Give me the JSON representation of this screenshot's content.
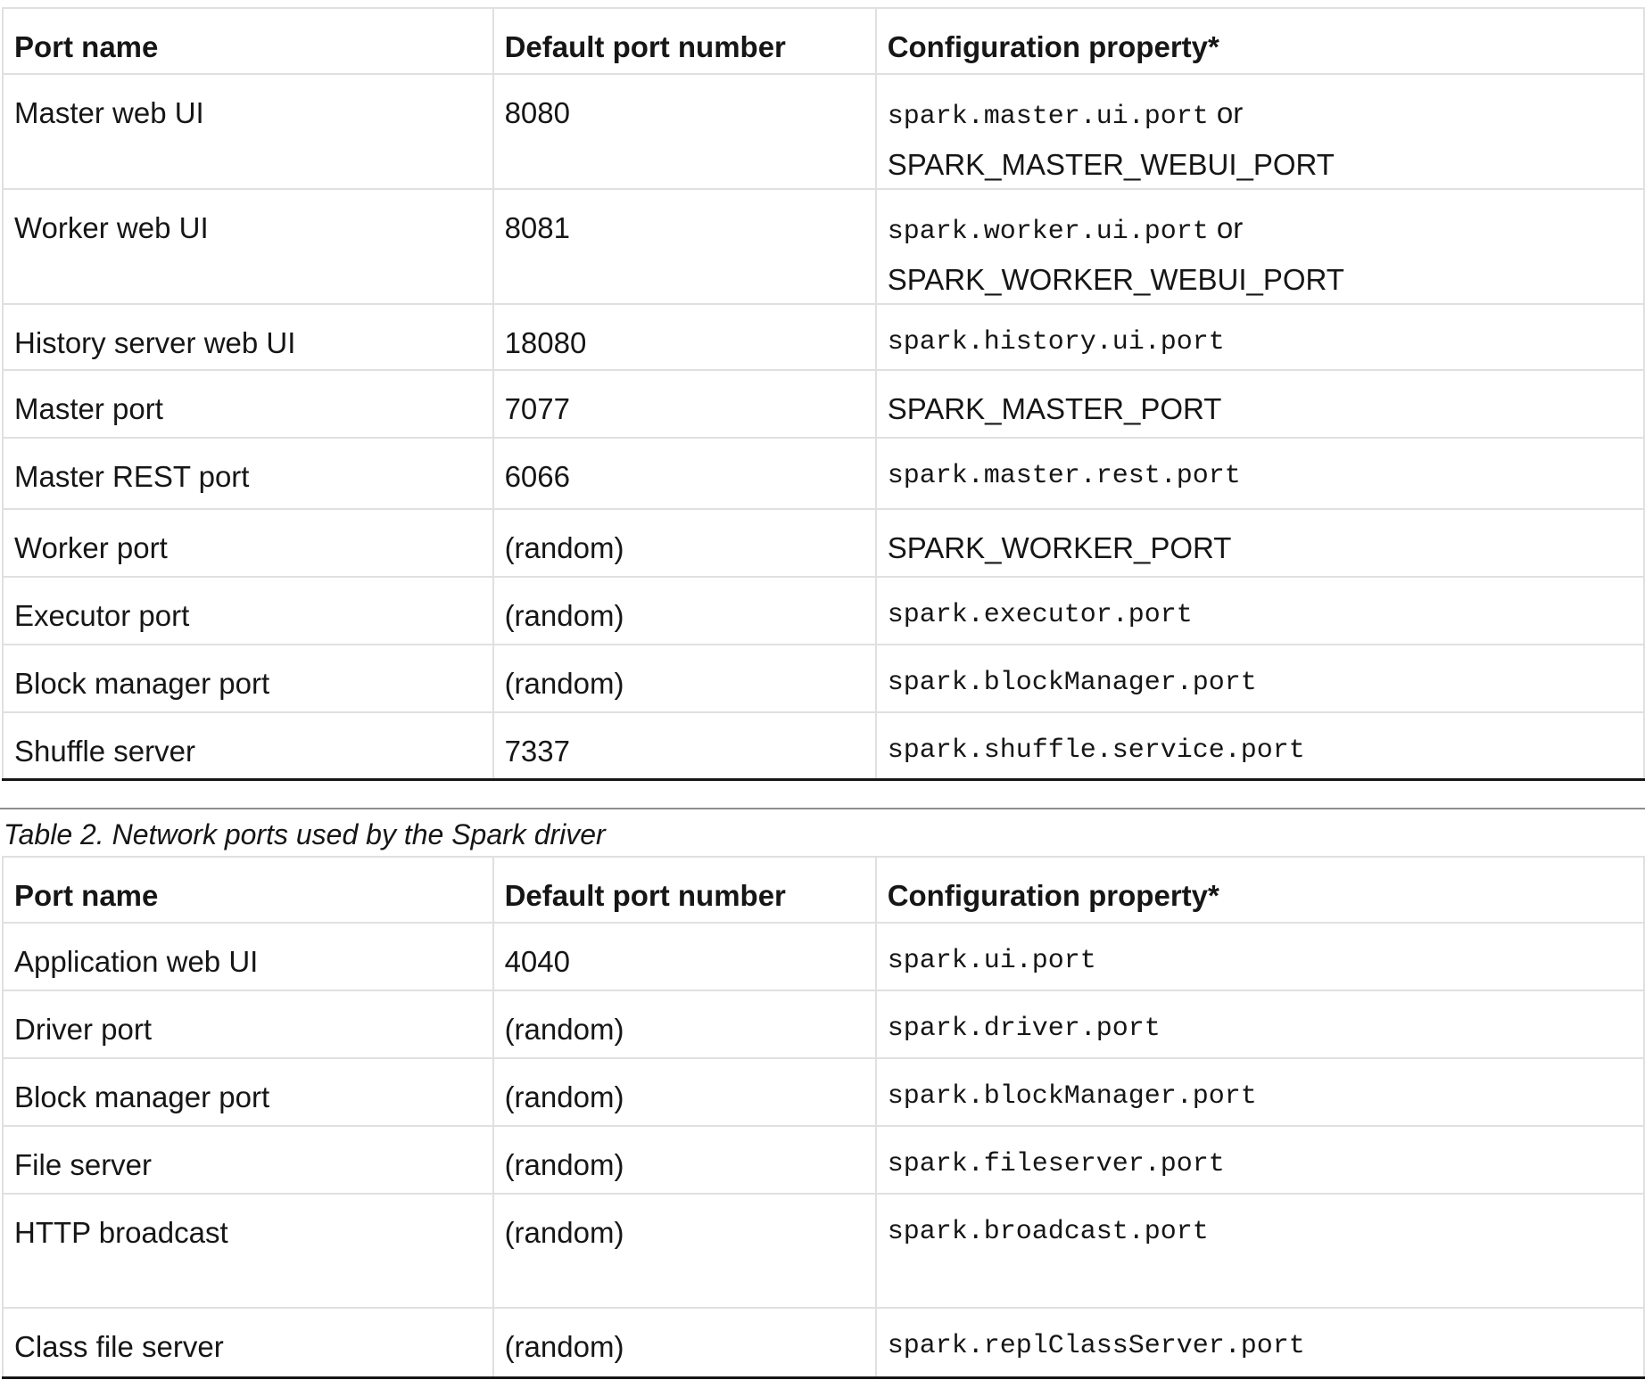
{
  "table1": {
    "headers": [
      "Port name",
      "Default port number",
      "Configuration property*"
    ],
    "rows": [
      {
        "name": "Master web UI",
        "port": "8080",
        "prop": "spark.master.ui.port",
        "or": "or",
        "env": "SPARK_MASTER_WEBUI_PORT"
      },
      {
        "name": "Worker web UI",
        "port": "8081",
        "prop": "spark.worker.ui.port",
        "or": "or",
        "env": "SPARK_WORKER_WEBUI_PORT"
      },
      {
        "name": "History server web UI",
        "port": "18080",
        "prop": "spark.history.ui.port"
      },
      {
        "name": "Master port",
        "port": "7077",
        "env": "SPARK_MASTER_PORT"
      },
      {
        "name": "Master REST port",
        "port": "6066",
        "prop": "spark.master.rest.port"
      },
      {
        "name": "Worker port",
        "port": "(random)",
        "env": "SPARK_WORKER_PORT"
      },
      {
        "name": "Executor port",
        "port": "(random)",
        "prop": "spark.executor.port"
      },
      {
        "name": "Block manager port",
        "port": "(random)",
        "prop": "spark.blockManager.port"
      },
      {
        "name": "Shuffle server",
        "port": "7337",
        "prop": "spark.shuffle.service.port"
      }
    ]
  },
  "table2": {
    "caption": "Table 2. Network ports used by the Spark driver",
    "headers": [
      "Port name",
      "Default port number",
      "Configuration property*"
    ],
    "rows": [
      {
        "name": "Application web UI",
        "port": "4040",
        "prop": "spark.ui.port"
      },
      {
        "name": "Driver port",
        "port": "(random)",
        "prop": "spark.driver.port"
      },
      {
        "name": "Block manager port",
        "port": "(random)",
        "prop": "spark.blockManager.port"
      },
      {
        "name": "File server",
        "port": "(random)",
        "prop": "spark.fileserver.port"
      },
      {
        "name": "HTTP broadcast",
        "port": "(random)",
        "prop": "spark.broadcast.port"
      },
      {
        "name": "Class file server",
        "port": "(random)",
        "prop": "spark.replClassServer.port"
      }
    ]
  }
}
